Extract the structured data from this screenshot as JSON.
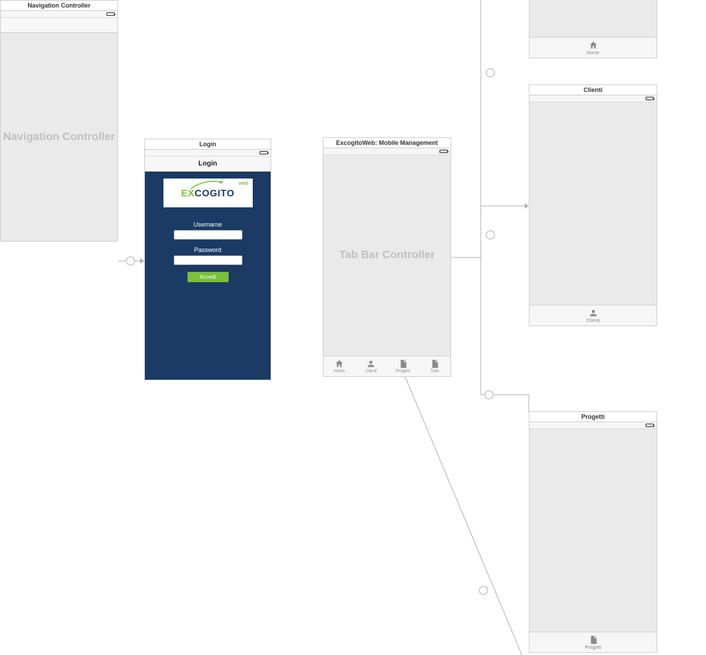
{
  "scenes": {
    "nav": {
      "title": "Navigation Controller",
      "placeholder": "Navigation Controller"
    },
    "login": {
      "title": "Login",
      "nav_title": "Login",
      "logo_main": "EXCOGITO",
      "logo_sub": "web",
      "username_label": "Username",
      "password_label": "Password",
      "submit_label": "Accedi"
    },
    "tabbar": {
      "title": "ExcogitoWeb: Mobile Management",
      "placeholder": "Tab Bar Controller",
      "tabs": [
        {
          "label": "Home"
        },
        {
          "label": "Clienti"
        },
        {
          "label": "Progetti"
        },
        {
          "label": "Todo"
        }
      ]
    },
    "home": {
      "tab_label": "Home"
    },
    "clienti": {
      "title": "Clienti",
      "tab_label": "Clienti"
    },
    "progetti": {
      "title": "Progetti",
      "tab_label": "Progetti"
    }
  }
}
